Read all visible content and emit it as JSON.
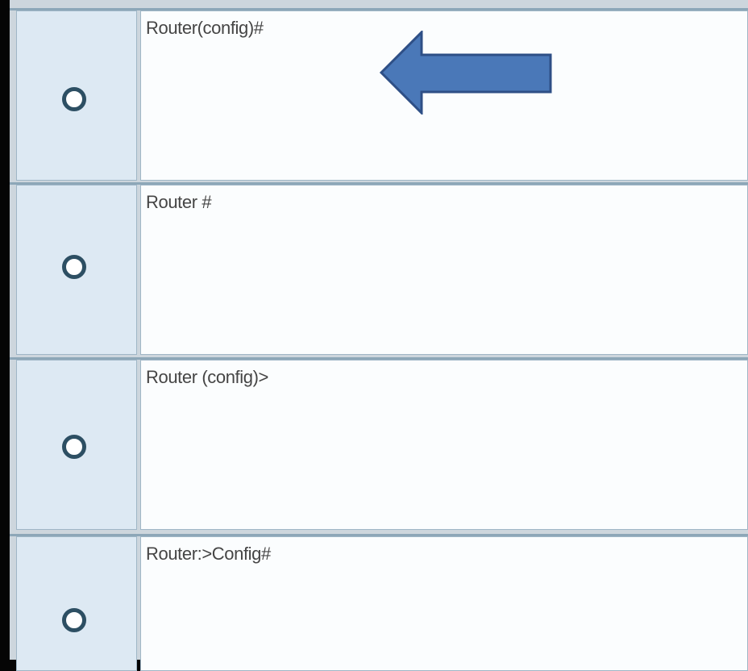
{
  "options": [
    {
      "label": "Router(config)#"
    },
    {
      "label": "Router #"
    },
    {
      "label": "Router (config)>"
    },
    {
      "label": "Router:>Config#"
    }
  ],
  "colors": {
    "arrow_fill": "#4a78b8",
    "arrow_stroke": "#2e4f86",
    "radio_ring": "#2d4f63",
    "radio_cell_bg": "#dde9f3",
    "answer_cell_bg": "#fbfdfe"
  },
  "annotation": {
    "icon": "left-arrow-icon",
    "points_to_option": 0
  }
}
